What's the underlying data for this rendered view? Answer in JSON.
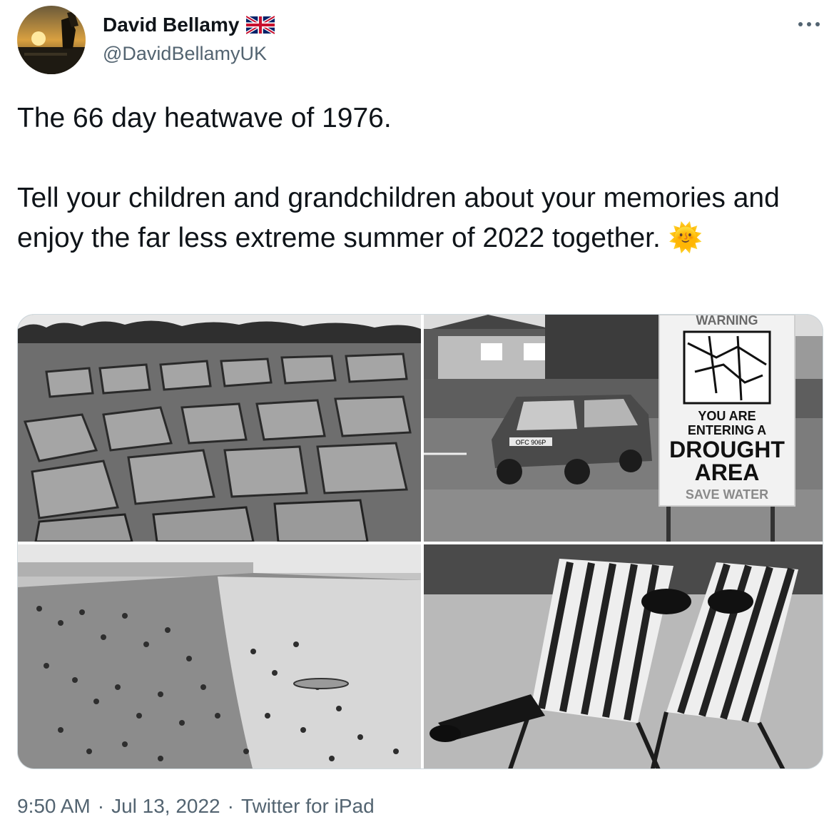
{
  "author": {
    "display_name": "David Bellamy",
    "handle": "@DavidBellamyUK",
    "flag_icon": "uk-flag-icon",
    "avatar_icon": "sunset-avatar"
  },
  "tweet": {
    "line1": "The 66 day heatwave of 1976.",
    "line2": "Tell your children and grandchildren about your memories and enjoy the far less extreme summer of 2022 together.",
    "emoji": "🌞"
  },
  "media": {
    "sign_warning": "WARNING",
    "sign_line1": "YOU ARE",
    "sign_line2": "ENTERING A",
    "sign_line3": "DROUGHT",
    "sign_line4": "AREA",
    "sign_line5": "SAVE WATER",
    "plate": "OFC 906P"
  },
  "meta": {
    "time": "9:50 AM",
    "dot1": "·",
    "date": "Jul 13, 2022",
    "dot2": "·",
    "source": "Twitter for iPad"
  },
  "colors": {
    "text": "#0f1419",
    "secondary": "#536471",
    "border": "#cfd9de"
  }
}
